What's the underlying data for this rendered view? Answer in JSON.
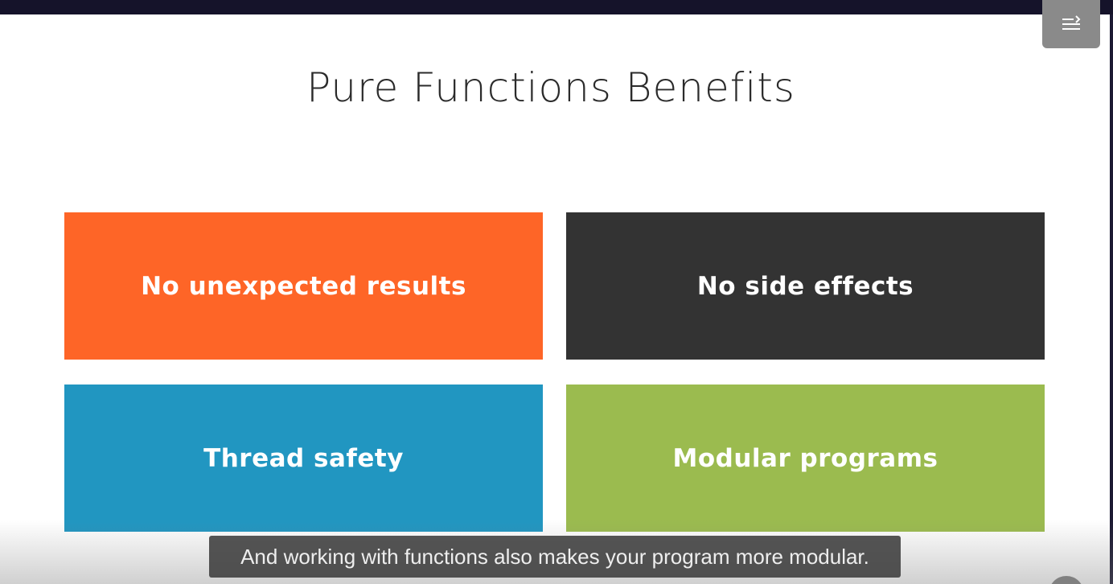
{
  "slide": {
    "title": "Pure Functions Benefits",
    "tiles": [
      {
        "label": "No unexpected results",
        "color": "#fe6527"
      },
      {
        "label": "No side effects",
        "color": "#333333"
      },
      {
        "label": "Thread safety",
        "color": "#2196c1"
      },
      {
        "label": "Modular programs",
        "color": "#9bbb4f"
      }
    ]
  },
  "player": {
    "caption": "And working with functions also makes your program more modular.",
    "menu_icon": "playlist-menu-icon",
    "corner_control_icon": "player-control-icon"
  },
  "colors": {
    "top_bar": "#15132a",
    "caption_background": "#3c3c3c",
    "menu_button": "#8a8a8a"
  }
}
